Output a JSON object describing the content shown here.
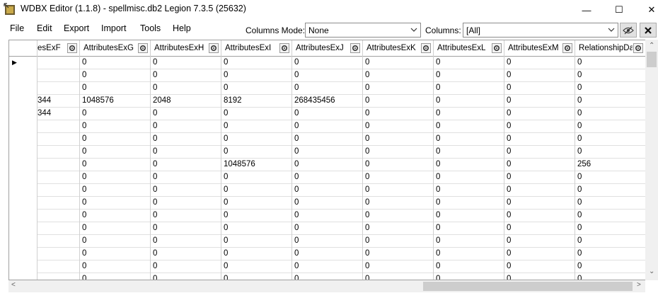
{
  "window": {
    "title": "WDBX Editor (1.1.8) - spellmisc.db2 Legion 7.3.5 (25632)",
    "min_glyph": "—",
    "max_glyph": "☐",
    "close_glyph": "✕"
  },
  "menu": [
    "File",
    "Edit",
    "Export",
    "Import",
    "Tools",
    "Help"
  ],
  "toolbar": {
    "columns_mode_label": "Columns Mode:",
    "columns_mode_value": "None",
    "columns_label": "Columns:",
    "columns_value": "[All]"
  },
  "grid": {
    "headers": [
      "esExF",
      "AttributesExG",
      "AttributesExH",
      "AttributesExI",
      "AttributesExJ",
      "AttributesExK",
      "AttributesExL",
      "AttributesExM",
      "RelationshipData"
    ],
    "rows": [
      [
        "",
        "0",
        "0",
        "0",
        "0",
        "0",
        "0",
        "0",
        "0"
      ],
      [
        "",
        "0",
        "0",
        "0",
        "0",
        "0",
        "0",
        "0",
        "0"
      ],
      [
        "",
        "0",
        "0",
        "0",
        "0",
        "0",
        "0",
        "0",
        "0"
      ],
      [
        "344",
        "1048576",
        "2048",
        "8192",
        "268435456",
        "0",
        "0",
        "0",
        "0"
      ],
      [
        "344",
        "0",
        "0",
        "0",
        "0",
        "0",
        "0",
        "0",
        "0"
      ],
      [
        "",
        "0",
        "0",
        "0",
        "0",
        "0",
        "0",
        "0",
        "0"
      ],
      [
        "",
        "0",
        "0",
        "0",
        "0",
        "0",
        "0",
        "0",
        "0"
      ],
      [
        "",
        "0",
        "0",
        "0",
        "0",
        "0",
        "0",
        "0",
        "0"
      ],
      [
        "",
        "0",
        "0",
        "1048576",
        "0",
        "0",
        "0",
        "0",
        "256"
      ],
      [
        "",
        "0",
        "0",
        "0",
        "0",
        "0",
        "0",
        "0",
        "0"
      ],
      [
        "",
        "0",
        "0",
        "0",
        "0",
        "0",
        "0",
        "0",
        "0"
      ],
      [
        "",
        "0",
        "0",
        "0",
        "0",
        "0",
        "0",
        "0",
        "0"
      ],
      [
        "",
        "0",
        "0",
        "0",
        "0",
        "0",
        "0",
        "0",
        "0"
      ],
      [
        "",
        "0",
        "0",
        "0",
        "0",
        "0",
        "0",
        "0",
        "0"
      ],
      [
        "",
        "0",
        "0",
        "0",
        "0",
        "0",
        "0",
        "0",
        "0"
      ],
      [
        "",
        "0",
        "0",
        "0",
        "0",
        "0",
        "0",
        "0",
        "0"
      ],
      [
        "",
        "0",
        "0",
        "0",
        "0",
        "0",
        "0",
        "0",
        "0"
      ],
      [
        "",
        "0",
        "0",
        "0",
        "0",
        "0",
        "0",
        "0",
        "0"
      ]
    ],
    "current_row_glyph": "▶"
  }
}
